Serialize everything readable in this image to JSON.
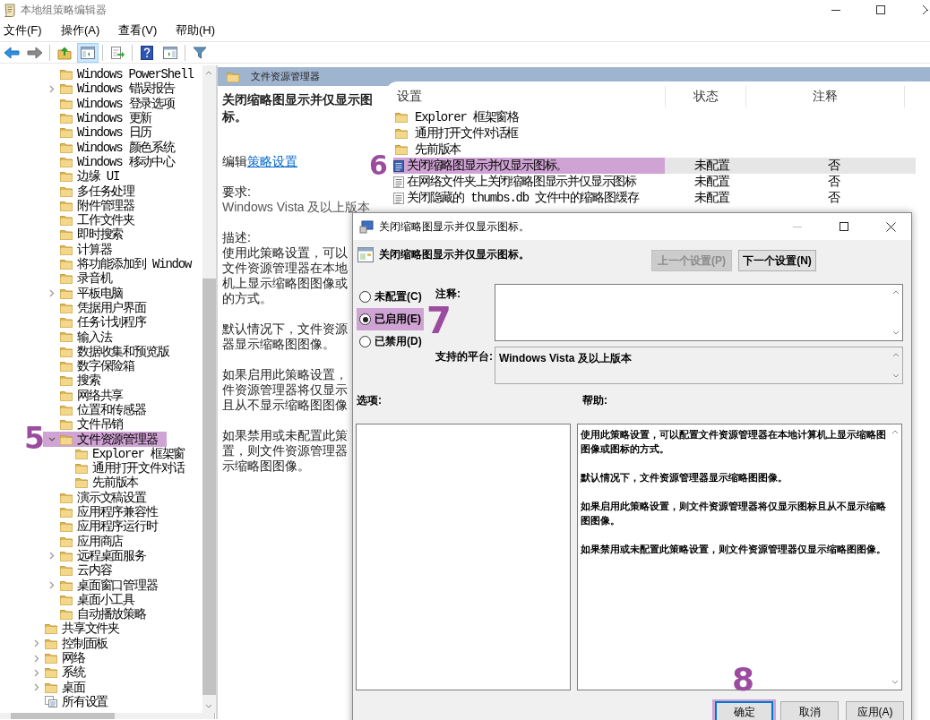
{
  "window": {
    "title": "本地组策略编辑器"
  },
  "menu": [
    "文件(F)",
    "操作(A)",
    "查看(V)",
    "帮助(H)"
  ],
  "toolbar": [
    {
      "pressed": false
    },
    {
      "pressed": false
    },
    {
      "pressed": false
    },
    {
      "pressed": true
    },
    {
      "pressed": false
    },
    {
      "pressed": false
    },
    {
      "pressed": false
    },
    {
      "pressed": false
    }
  ],
  "tree": [
    {
      "kind": "group",
      "children": [
        {
          "kind": "folder",
          "label": "Windows PowerShell"
        },
        {
          "kind": "folder",
          "label": "Windows 错误报告",
          "expanded": false
        },
        {
          "kind": "folder",
          "label": "Windows 登录选项"
        },
        {
          "kind": "folder",
          "label": "Windows 更新"
        },
        {
          "kind": "folder",
          "label": "Windows 日历"
        },
        {
          "kind": "folder",
          "label": "Windows 颜色系统"
        },
        {
          "kind": "folder",
          "label": "Windows 移动中心"
        },
        {
          "kind": "folder",
          "label": "边缘 UI"
        },
        {
          "kind": "folder",
          "label": "多任务处理"
        },
        {
          "kind": "folder",
          "label": "附件管理器"
        },
        {
          "kind": "folder",
          "label": "工作文件夹"
        },
        {
          "kind": "folder",
          "label": "即时搜索"
        },
        {
          "kind": "folder",
          "label": "计算器"
        },
        {
          "kind": "folder",
          "label": "将功能添加到 Window"
        },
        {
          "kind": "folder",
          "label": "录音机"
        },
        {
          "kind": "folder",
          "label": "平板电脑",
          "expanded": false
        },
        {
          "kind": "folder",
          "label": "凭据用户界面"
        },
        {
          "kind": "folder",
          "label": "任务计划程序"
        },
        {
          "kind": "folder",
          "label": "输入法"
        },
        {
          "kind": "folder",
          "label": "数据收集和预览版"
        },
        {
          "kind": "folder",
          "label": "数字保险箱"
        },
        {
          "kind": "folder",
          "label": "搜索"
        },
        {
          "kind": "folder",
          "label": "网络共享"
        },
        {
          "kind": "folder",
          "label": "位置和传感器"
        },
        {
          "kind": "folder",
          "label": "文件吊销"
        },
        {
          "kind": "folder",
          "label": "文件资源管理器",
          "expanded": true,
          "marker": "5",
          "children": [
            {
              "kind": "folder",
              "label": "Explorer 框架窗"
            },
            {
              "kind": "folder",
              "label": "通用打开文件对话"
            },
            {
              "kind": "folder",
              "label": "先前版本"
            }
          ]
        },
        {
          "kind": "folder",
          "label": "演示文稿设置"
        },
        {
          "kind": "folder",
          "label": "应用程序兼容性"
        },
        {
          "kind": "folder",
          "label": "应用程序运行时"
        },
        {
          "kind": "folder",
          "label": "应用商店"
        },
        {
          "kind": "folder",
          "label": "远程桌面服务",
          "expanded": false
        },
        {
          "kind": "folder",
          "label": "云内容"
        },
        {
          "kind": "folder",
          "label": "桌面窗口管理器",
          "expanded": false
        },
        {
          "kind": "folder",
          "label": "桌面小工具"
        },
        {
          "kind": "folder",
          "label": "自动播放策略"
        }
      ]
    },
    {
      "kind": "folder",
      "label": "共享文件夹"
    },
    {
      "kind": "folder",
      "label": "控制面板",
      "expanded": false
    },
    {
      "kind": "folder",
      "label": "网络",
      "expanded": false
    },
    {
      "kind": "folder",
      "label": "系统",
      "expanded": false
    },
    {
      "kind": "folder",
      "label": "桌面",
      "expanded": false
    },
    {
      "kind": "settings",
      "label": "所有设置"
    }
  ],
  "pane_title": "文件资源管理器",
  "description": {
    "title": "关闭缩略图显示并仅显示图标。",
    "edit_prefix": "编辑",
    "edit_link": "策略设置",
    "requirement_label": "要求:",
    "requirement": "Windows Vista 及以上版本",
    "description_label": "描述:",
    "paragraphs": [
      [
        "使用此策略设置，可以",
        "文件资源管理器在本地",
        "机上显示缩略图图像或",
        "的方式。"
      ],
      [
        "默认情况下，文件资源",
        "器显示缩略图图像。"
      ],
      [
        "如果启用此策略设置，",
        "件资源管理器将仅显示",
        "且从不显示缩略图图像"
      ],
      [
        "如果禁用或未配置此策",
        "置，则文件资源管理器",
        "示缩略图图像。"
      ]
    ]
  },
  "list": {
    "columns": [
      "设置",
      "状态",
      "注释"
    ],
    "rows": [
      {
        "kind": "folder",
        "name": "Explorer 框架窗格",
        "selected": false
      },
      {
        "kind": "folder",
        "name": "通用打开文件对话框",
        "selected": false
      },
      {
        "kind": "folder",
        "name": "先前版本",
        "selected": false
      },
      {
        "kind": "setting",
        "name": "关闭缩略图显示并仅显示图标。",
        "state": "未配置",
        "comment": "否",
        "selected": true,
        "marker": "6"
      },
      {
        "kind": "setting",
        "name": "在网络文件夹上关闭缩略图显示并仅显示图标",
        "state": "未配置",
        "comment": "否",
        "selected": false
      },
      {
        "kind": "setting",
        "name": "关闭隐藏的 thumbs.db 文件中的缩略图缓存",
        "state": "未配置",
        "comment": "否",
        "selected": false
      }
    ]
  },
  "dialog": {
    "title": "关闭缩略图显示并仅显示图标。",
    "heading": "关闭缩略图显示并仅显示图标。",
    "prev_button": {
      "label": "上一个设置(P)",
      "disabled": true
    },
    "next_button": {
      "label": "下一个设置(N)",
      "disabled": false
    },
    "radios": [
      {
        "label": "未配置(C)",
        "selected": false
      },
      {
        "label": "已启用(E)",
        "selected": true,
        "marker": "7"
      },
      {
        "label": "已禁用(D)",
        "selected": false
      }
    ],
    "comment_label": "注释:",
    "platform_label": "支持的平台:",
    "platform": "Windows Vista 及以上版本",
    "options_label": "选项:",
    "help_label": "帮助:",
    "help": [
      "使用此策略设置，可以配置文件资源管理器在本地计算机上显示缩略图图像或图标的方式。",
      "默认情况下，文件资源管理器显示缩略图图像。",
      "如果启用此策略设置，则文件资源管理器将仅显示图标且从不显示缩略图图像。",
      "如果禁用或未配置此策略设置，则文件资源管理器仅显示缩略图图像。"
    ],
    "buttons": [
      {
        "label": "确定",
        "default": true,
        "marker": "8"
      },
      {
        "label": "取消",
        "default": false
      },
      {
        "label": "应用(A)",
        "default": false
      }
    ]
  }
}
